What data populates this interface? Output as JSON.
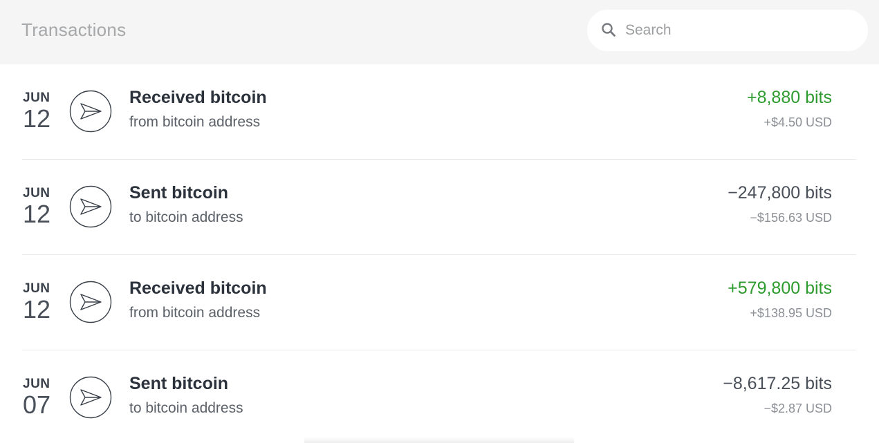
{
  "header": {
    "title": "Transactions",
    "search": {
      "placeholder": "Search",
      "value": ""
    }
  },
  "icons": {
    "search": "search-icon",
    "transaction": "send-icon"
  },
  "colors": {
    "positive": "#2e9b2e",
    "neutral": "#4a5059",
    "header_bg": "#f5f5f5"
  },
  "transactions": [
    {
      "month": "JUN",
      "day": "12",
      "title": "Received bitcoin",
      "subtitle": "from bitcoin address",
      "amount": "+8,880 bits",
      "fiat": "+$4.50 USD",
      "direction": "received"
    },
    {
      "month": "JUN",
      "day": "12",
      "title": "Sent bitcoin",
      "subtitle": "to bitcoin address",
      "amount": "−247,800 bits",
      "fiat": "−$156.63 USD",
      "direction": "sent"
    },
    {
      "month": "JUN",
      "day": "12",
      "title": "Received bitcoin",
      "subtitle": "from bitcoin address",
      "amount": "+579,800 bits",
      "fiat": "+$138.95 USD",
      "direction": "received"
    },
    {
      "month": "JUN",
      "day": "07",
      "title": "Sent bitcoin",
      "subtitle": "to bitcoin address",
      "amount": "−8,617.25 bits",
      "fiat": "−$2.87 USD",
      "direction": "sent"
    }
  ]
}
